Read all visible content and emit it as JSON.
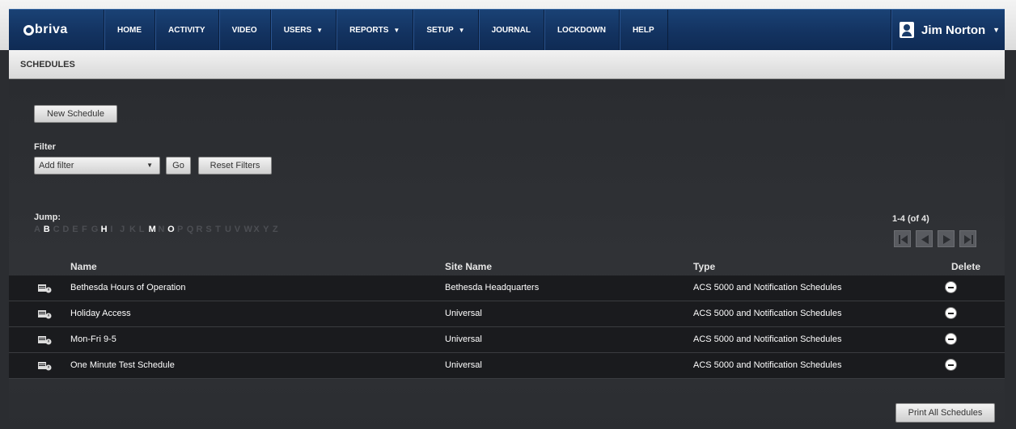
{
  "nav": {
    "logo": "briva",
    "items": [
      {
        "label": "HOME",
        "dropdown": false
      },
      {
        "label": "ACTIVITY",
        "dropdown": false
      },
      {
        "label": "VIDEO",
        "dropdown": false
      },
      {
        "label": "USERS",
        "dropdown": true
      },
      {
        "label": "REPORTS",
        "dropdown": true
      },
      {
        "label": "SETUP",
        "dropdown": true
      },
      {
        "label": "JOURNAL",
        "dropdown": false
      },
      {
        "label": "LOCKDOWN",
        "dropdown": false
      },
      {
        "label": "HELP",
        "dropdown": false
      }
    ],
    "user_name": "Jim Norton"
  },
  "page": {
    "title": "SCHEDULES"
  },
  "toolbar": {
    "new_schedule": "New Schedule",
    "filter_label": "Filter",
    "filter_select_value": "Add filter",
    "go": "Go",
    "reset_filters": "Reset Filters"
  },
  "jump": {
    "label": "Jump:",
    "letters": [
      {
        "letter": "A",
        "active": false
      },
      {
        "letter": "B",
        "active": true
      },
      {
        "letter": "C",
        "active": false
      },
      {
        "letter": "D",
        "active": false
      },
      {
        "letter": "E",
        "active": false
      },
      {
        "letter": "F",
        "active": false
      },
      {
        "letter": "G",
        "active": false
      },
      {
        "letter": "H",
        "active": true
      },
      {
        "letter": "I",
        "active": false
      },
      {
        "letter": "J",
        "active": false
      },
      {
        "letter": "K",
        "active": false
      },
      {
        "letter": "L",
        "active": false
      },
      {
        "letter": "M",
        "active": true
      },
      {
        "letter": "N",
        "active": false
      },
      {
        "letter": "O",
        "active": true
      },
      {
        "letter": "P",
        "active": false
      },
      {
        "letter": "Q",
        "active": false
      },
      {
        "letter": "R",
        "active": false
      },
      {
        "letter": "S",
        "active": false
      },
      {
        "letter": "T",
        "active": false
      },
      {
        "letter": "U",
        "active": false
      },
      {
        "letter": "V",
        "active": false
      },
      {
        "letter": "W",
        "active": false
      },
      {
        "letter": "X",
        "active": false
      },
      {
        "letter": "Y",
        "active": false
      },
      {
        "letter": "Z",
        "active": false
      }
    ]
  },
  "pager": {
    "count": "1-4 (of 4)"
  },
  "table": {
    "headers": {
      "name": "Name",
      "site": "Site Name",
      "type": "Type",
      "delete": "Delete"
    },
    "rows": [
      {
        "name": "Bethesda Hours of Operation",
        "site": "Bethesda Headquarters",
        "type": "ACS 5000 and Notification Schedules"
      },
      {
        "name": "Holiday Access",
        "site": "Universal",
        "type": "ACS 5000 and Notification Schedules"
      },
      {
        "name": "Mon-Fri 9-5",
        "site": "Universal",
        "type": "ACS 5000 and Notification Schedules"
      },
      {
        "name": "One Minute Test Schedule",
        "site": "Universal",
        "type": "ACS 5000 and Notification Schedules"
      }
    ]
  },
  "footer": {
    "print_all": "Print All Schedules"
  },
  "colors": {
    "nav_bg": "#133361",
    "content_bg": "#2b2d31",
    "row_bg": "#1a1b1e"
  }
}
